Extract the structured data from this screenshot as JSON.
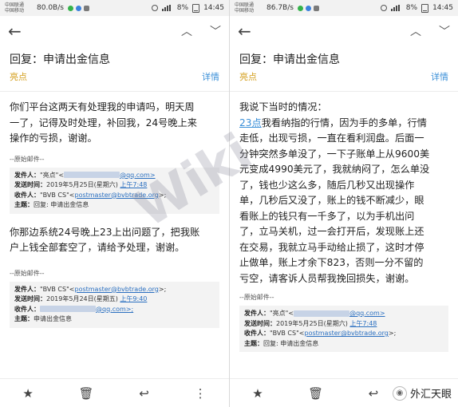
{
  "left": {
    "status": {
      "carrier1": "中国联通",
      "carrier2": "中国移动",
      "speed": "80.0B/s",
      "battery": "8%",
      "time": "14:45"
    },
    "subject": "回复：申请出金信息",
    "sender": "亮点",
    "details": "详情",
    "body": [
      "你们平台这两天有处理我的申请吗，明天周",
      "一了，记得及时处理，补回我，24号晚上来",
      "操作的亏损，谢谢。"
    ],
    "orig1": {
      "label": "--原始邮件--",
      "from_label": "发件人：",
      "from_value": "\"亮点\"<",
      "from_tail": "@qq.com>",
      "date_label": "发送时间：",
      "date_value": "2019年5月25日(星期六)",
      "date_time": "上午7:48",
      "to_label": "收件人：",
      "to_value": "\"BVB CS\"<",
      "to_email": "postmaster@bvbtrade.org",
      "to_tail": ">;",
      "subj_label": "主题：",
      "subj_value": "回复: 申请出金信息"
    },
    "body2": [
      "你那边系统24号晚上23上出问题了，把我账",
      "户上钱全部套空了，请给予处理，谢谢。"
    ],
    "orig2": {
      "label": "--原始邮件--",
      "from_label": "发件人：",
      "from_value": "\"BVB CS\"<",
      "from_email": "postmaster@bvbtrade.org",
      "from_tail": ">;",
      "date_label": "发送时间：",
      "date_value": "2019年5月24日(星期五)",
      "date_time": "上午9:40",
      "to_label": "收件人：",
      "to_tail": "@qq.com>;",
      "subj_label": "主题：",
      "subj_value": "申请出金信息"
    }
  },
  "right": {
    "status": {
      "carrier1": "中国联通",
      "carrier2": "中国移动",
      "speed": "86.7B/s",
      "battery": "8%",
      "time": "14:45"
    },
    "subject": "回复：申请出金信息",
    "sender": "亮点",
    "details": "详情",
    "intro": "我说下当时的情况：",
    "link_text": "23点",
    "body_after_link": "我看纳指的行情，因为手的多单，行情",
    "body": [
      "走低，出现亏损，一直在看利润盘。后面一",
      "分钟突然多单没了，一下子账单上从9600美",
      "元变成4990美元了，我就纳闷了，怎么单没",
      "了，钱也少这么多，随后几秒又出现操作",
      "单，几秒后又没了，账上的钱不断减少，眼",
      "看账上的钱只有一千多了，以为手机出问",
      "了，立马关机，过一会打开后，发现账上还",
      "在交易，我就立马手动给止损了，这时才停",
      "止做单，账上才余下823，否则一分不留的",
      "亏空，请客诉人员帮我挽回损失，谢谢。"
    ],
    "orig": {
      "label": "--原始邮件--",
      "from_label": "发件人：",
      "from_value": "\"亮点\"<",
      "from_tail": "@qq.com>",
      "date_label": "发送时间：",
      "date_value": "2019年5月25日(星期六)",
      "date_time": "上午7:48",
      "to_label": "收件人：",
      "to_value": "\"BVB CS\"<",
      "to_email": "postmaster@bvbtrade.org",
      "to_tail": ">;",
      "subj_label": "主题：",
      "subj_value": "回复: 申请出金信息"
    },
    "badge": "外汇天眼"
  },
  "watermark": "Wiki",
  "icons": [
    "back-arrow-icon",
    "up-arrow-icon",
    "down-arrow-icon",
    "star-icon",
    "trash-icon",
    "reply-icon",
    "more-icon"
  ]
}
